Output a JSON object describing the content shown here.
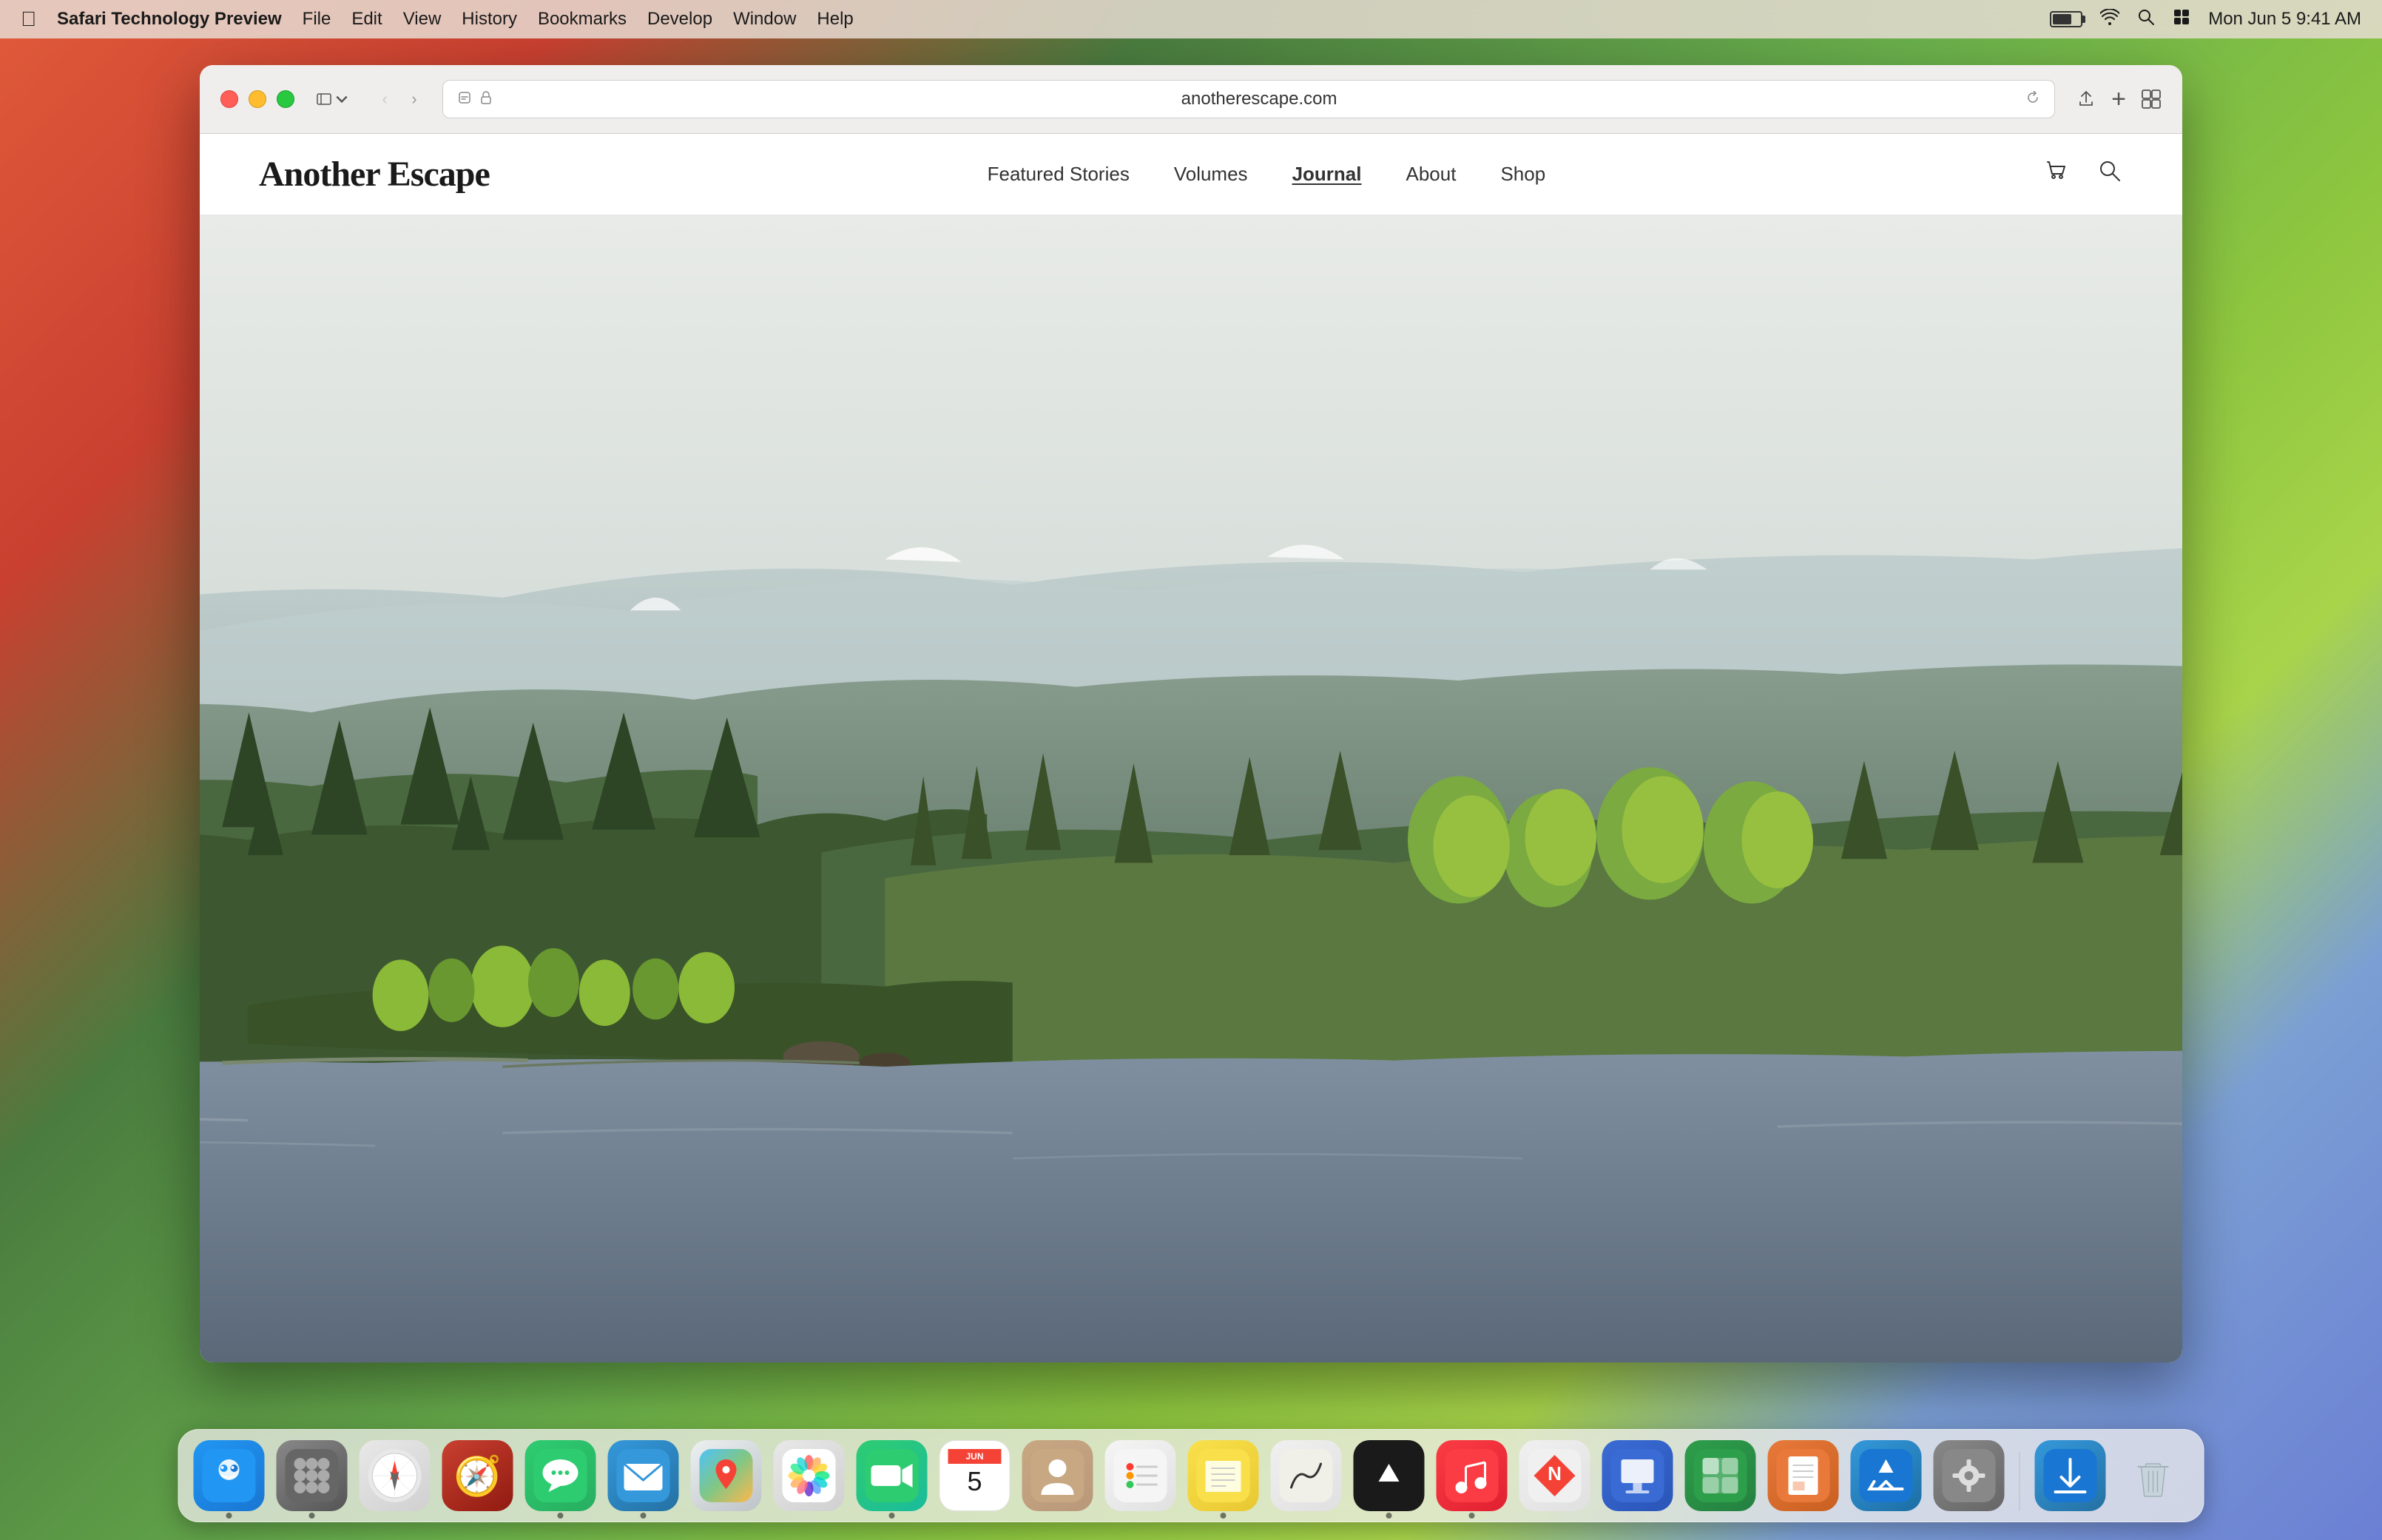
{
  "desktop": {
    "background": "macOS Sonoma gradient"
  },
  "menubar": {
    "apple_label": "",
    "app_name": "Safari Technology Preview",
    "items": [
      "File",
      "Edit",
      "View",
      "History",
      "Bookmarks",
      "Develop",
      "Window",
      "Help"
    ],
    "time": "Mon Jun 5  9:41 AM"
  },
  "browser": {
    "url": "anotherescape.com",
    "tabs": []
  },
  "website": {
    "logo": "Another Escape",
    "nav": {
      "items": [
        {
          "label": "Featured Stories",
          "active": false
        },
        {
          "label": "Volumes",
          "active": false
        },
        {
          "label": "Journal",
          "active": true
        },
        {
          "label": "About",
          "active": false
        },
        {
          "label": "Shop",
          "active": false
        }
      ]
    },
    "hero": {
      "alt": "Scottish highland landscape with lake and pine forest"
    }
  },
  "dock": {
    "items": [
      {
        "name": "Finder",
        "icon": "finder"
      },
      {
        "name": "Launchpad",
        "icon": "launchpad"
      },
      {
        "name": "Safari",
        "icon": "safari"
      },
      {
        "name": "Compass",
        "icon": "compass"
      },
      {
        "name": "Messages",
        "icon": "messages"
      },
      {
        "name": "Mail",
        "icon": "mail"
      },
      {
        "name": "Maps",
        "icon": "maps"
      },
      {
        "name": "Photos",
        "icon": "photos"
      },
      {
        "name": "FaceTime",
        "icon": "facetime"
      },
      {
        "name": "Calendar",
        "icon": "calendar",
        "date_num": "5",
        "month": "JUN"
      },
      {
        "name": "Contacts",
        "icon": "contacts"
      },
      {
        "name": "Reminders",
        "icon": "reminders"
      },
      {
        "name": "Notes",
        "icon": "notes"
      },
      {
        "name": "Freeform",
        "icon": "freeform"
      },
      {
        "name": "Apple TV",
        "icon": "appletv"
      },
      {
        "name": "Music",
        "icon": "music"
      },
      {
        "name": "News",
        "icon": "news"
      },
      {
        "name": "Keynote",
        "icon": "keynote"
      },
      {
        "name": "Numbers",
        "icon": "numbers"
      },
      {
        "name": "Pages",
        "icon": "pages"
      },
      {
        "name": "App Store",
        "icon": "appstore"
      },
      {
        "name": "System Preferences",
        "icon": "systemprefs"
      },
      {
        "name": "Downloads",
        "icon": "downloads"
      },
      {
        "name": "Trash",
        "icon": "trash"
      }
    ]
  }
}
